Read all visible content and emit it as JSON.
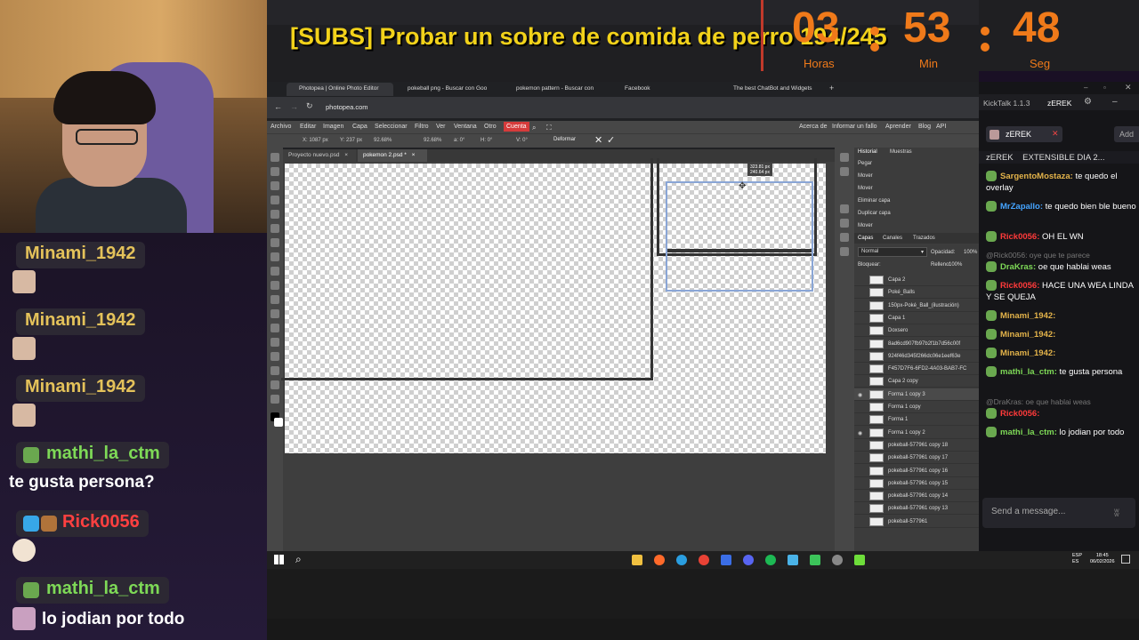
{
  "banner": {
    "title": "[SUBS] Probar un sobre de comida de perro 194/245",
    "timer": {
      "hours": "03",
      "minutes": "53",
      "seconds": "48",
      "hours_label": "Horas",
      "minutes_label": "Min",
      "seconds_label": "Seg"
    }
  },
  "left_chat": [
    {
      "user": "Minami_1942",
      "message": "",
      "color": "#e4c25a"
    },
    {
      "user": "Minami_1942",
      "message": "",
      "color": "#e4c25a"
    },
    {
      "user": "Minami_1942",
      "message": "",
      "color": "#e4c25a"
    },
    {
      "user": "mathi_la_ctm",
      "message": "te gusta persona?",
      "color": "#7ed957"
    },
    {
      "user": "Rick0056",
      "message": "",
      "color": "#ff4040"
    },
    {
      "user": "mathi_la_ctm",
      "message": "lo jodian por todo",
      "color": "#7ed957"
    }
  ],
  "browser": {
    "tabs": [
      "Photopea | Online Photo Editor",
      "pokeball png - Buscar con Goo",
      "pokemon pattern - Buscar con",
      "Facebook",
      "The best ChatBot and Widgets"
    ],
    "url": "photopea.com"
  },
  "photopea": {
    "menu": [
      "Archivo",
      "Editar",
      "Imagen",
      "Capa",
      "Seleccionar",
      "Filtro",
      "Ver",
      "Ventana",
      "Otro",
      "Cuenta"
    ],
    "menu_right": [
      "Acerca de",
      "Informar un fallo",
      "Aprender",
      "Blog",
      "API"
    ],
    "toolbar": {
      "x": "X: 1087 px",
      "y": "Y: 237 px",
      "w": "92.68%",
      "h": "92.68%",
      "angle": "a: 0°",
      "hskew": "H: 0°",
      "vskew": "V: 0°",
      "deform": "Deformar"
    },
    "doc_tabs": [
      "Proyecto nuevo.psd",
      "pokemon 2.psd *"
    ],
    "measure": "323.81 px",
    "measure2": "240.64 px",
    "history_tabs": [
      "Historial",
      "Muestras"
    ],
    "history": [
      "Pegar",
      "Mover",
      "Mover",
      "Eliminar capa",
      "Duplicar capa",
      "Mover"
    ],
    "layer_tabs": [
      "Capas",
      "Canales",
      "Trazados"
    ],
    "blend_mode": "Normal",
    "opacity_label": "Opacidad:",
    "opacity": "100%",
    "lock_label": "Bloquear:",
    "fill_label": "Relleno:",
    "fill": "100%",
    "layers": [
      "Capa 2",
      "Poké_Balls",
      "150px-Poké_Ball_(ilustración)",
      "Capa 1",
      "Doxsero",
      "8ad6cd907fb97b2f1b7d56c00f",
      "924f46d345f266dc06e1eef63e",
      "F457D7F6-6FD2-4A03-BAB7-FC",
      "Capa 2 copy",
      "Forma 1 copy 3",
      "Forma 1 copy",
      "Forma 1",
      "Forma 1 copy 2",
      "pokeball-577961 copy 18",
      "pokeball-577961 copy 17",
      "pokeball-577961 copy 16",
      "pokeball-577961 copy 15",
      "pokeball-577961 copy 14",
      "pokeball-577961 copy 13",
      "pokeball-577961"
    ]
  },
  "kicktalk": {
    "app": "KickTalk 1.1.3",
    "channel_tab": "zEREK",
    "active_channel": "zEREK",
    "add_label": "Add",
    "stream_title": "zEREK    EXTENSIBLE DIA 2...",
    "messages": [
      {
        "user": "SargentoMostaza:",
        "text": "te quedo el overlay",
        "cls": "gold"
      },
      {
        "user": "MrZapallo:",
        "text": "te quedo bien ble bueno",
        "cls": "blue"
      },
      {
        "user": "Rick0056:",
        "text": "OH EL WN",
        "cls": "red"
      },
      {
        "reply": "@Rick0056: oye que te parece",
        "user": "DraKras:",
        "text": "oe que hablai weas",
        "cls": "green"
      },
      {
        "user": "Rick0056:",
        "text": "HACE UNA WEA LINDA Y SE QUEJA",
        "cls": "red"
      },
      {
        "user": "Minami_1942:",
        "text": "",
        "cls": "gold"
      },
      {
        "user": "Minami_1942:",
        "text": "",
        "cls": "gold"
      },
      {
        "user": "Minami_1942:",
        "text": "",
        "cls": "gold"
      },
      {
        "user": "mathi_la_ctm:",
        "text": "te gusta persona",
        "cls": "green"
      },
      {
        "reply": "@DraKras: oe que hablai weas",
        "user": "Rick0056:",
        "text": "",
        "cls": "red"
      },
      {
        "user": "mathi_la_ctm:",
        "text": "lo jodian por todo",
        "cls": "green"
      }
    ],
    "input_placeholder": "Send a message..."
  },
  "taskbar": {
    "lang": "ESP\nES",
    "time": "18:45",
    "date": "06/02/2026"
  }
}
